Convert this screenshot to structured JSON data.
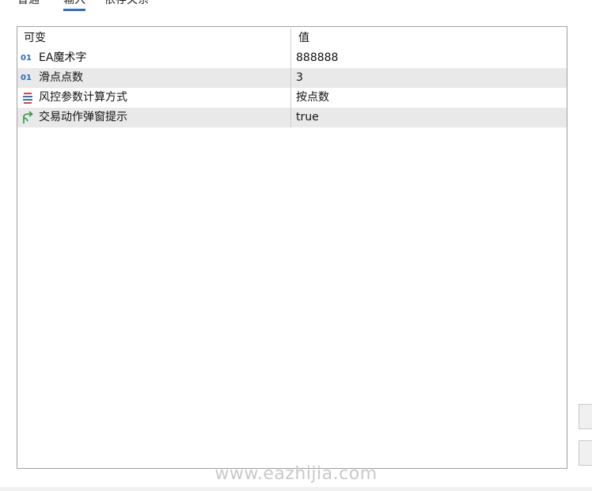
{
  "tabs": [
    {
      "label": "普通",
      "active": false
    },
    {
      "label": "输入",
      "active": true
    },
    {
      "label": "依存关系",
      "active": false
    }
  ],
  "table": {
    "headers": {
      "name": "可变",
      "value": "值"
    },
    "rows": [
      {
        "icon": "number-01-icon",
        "icon_text": "01",
        "name": "EA魔术字",
        "value": "888888"
      },
      {
        "icon": "number-01-icon",
        "icon_text": "01",
        "name": "滑点点数",
        "value": "3"
      },
      {
        "icon": "enum-list-icon",
        "icon_text": "",
        "name": "风控参数计算方式",
        "value": "按点数"
      },
      {
        "icon": "boolean-branch-icon",
        "icon_text": "",
        "name": "交易动作弹窗提示",
        "value": "true"
      }
    ]
  },
  "watermark": "www.eazhijia.com",
  "colors": {
    "tab_underline": "#2f6fc6",
    "number_icon": "#2d6cc0",
    "enum_icon_red": "#d0473c",
    "enum_icon_blue": "#3a6fc0",
    "bool_icon_green": "#2a9a3a",
    "row_alt": "#e9e9e9"
  }
}
